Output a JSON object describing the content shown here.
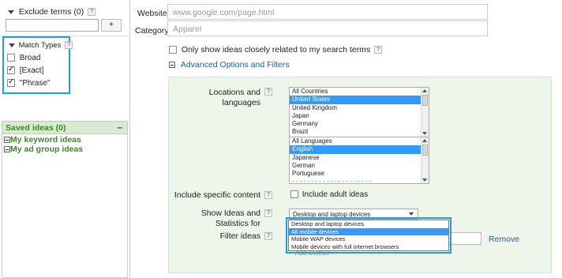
{
  "left": {
    "exclude_terms_label": "Exclude terms (0)",
    "help_glyph": "?",
    "add_button": "+",
    "match_types": {
      "title": "Match Types",
      "options": [
        {
          "label": "Broad",
          "checked": false
        },
        {
          "label": "[Exact]",
          "checked": true
        },
        {
          "label": "\"Phrase\"",
          "checked": true
        }
      ]
    },
    "saved_ideas": {
      "title": "Saved ideas (0)",
      "collapse": "–",
      "items": [
        "My keyword ideas",
        "My ad group ideas"
      ]
    }
  },
  "top": {
    "website_label": "Website",
    "website_placeholder": "www.google.com/page.html",
    "category_label": "Category",
    "category_placeholder": "Apparel",
    "closely_related": "Only show ideas closely related to my search terms",
    "advanced_link": "Advanced Options and Filters"
  },
  "advanced": {
    "locations_label_1": "Locations and",
    "locations_label_2": "languages",
    "locations": [
      "All Countries",
      "United States",
      "United Kingdom",
      "Japan",
      "Germany",
      "Brazil"
    ],
    "locations_selected": "United States",
    "languages": [
      "All Languages",
      "English",
      "Japanese",
      "German",
      "Portuguese"
    ],
    "languages_selected": "English",
    "include_label": "Include specific content",
    "include_adult": "Include adult ideas",
    "show_label_1": "Show Ideas and",
    "show_label_2": "Statistics for",
    "device_selected": "Desktop and laptop devices",
    "device_options": [
      "Desktop and laptop devices",
      "All mobile devices",
      "Mobile WAP devices",
      "Mobile devices with full internet browsers"
    ],
    "device_highlighted": "All mobile devices",
    "filter_label": "Filter ideas",
    "remove_link": "Remove",
    "underlying_text": "Add another"
  },
  "colors": {
    "highlight_box": "#1ea0dc",
    "saved_header_bg": "#d9ead3",
    "advanced_panel_bg": "#eef5ea",
    "selection": "#3399ff",
    "link": "#1a5fb4",
    "green_text": "#3a8a23"
  }
}
